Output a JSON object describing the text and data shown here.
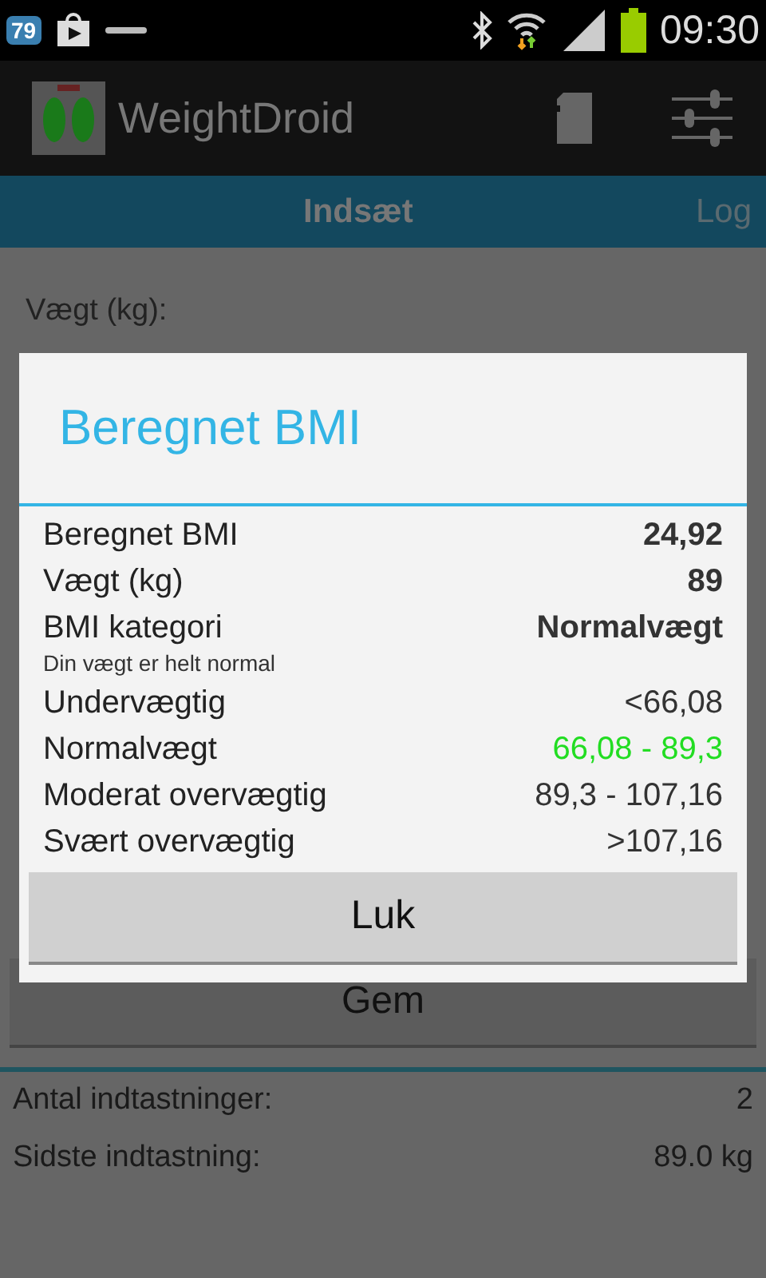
{
  "status_bar": {
    "notification_count": "79",
    "time": "09:30"
  },
  "action_bar": {
    "title": "WeightDroid"
  },
  "tabs": [
    {
      "label": "Indsæt",
      "selected": true
    },
    {
      "label": "Log",
      "selected": false
    }
  ],
  "form": {
    "weight_label": "Vægt (kg):",
    "save_button": "Gem"
  },
  "stats": [
    {
      "label": "Antal indtastninger:",
      "value": "2"
    },
    {
      "label": "Sidste indtastning:",
      "value": "89.0 kg"
    }
  ],
  "dialog": {
    "title": "Beregnet BMI",
    "rows": [
      {
        "label": "Beregnet BMI",
        "value": "24,92",
        "bold": true
      },
      {
        "label": "Vægt (kg)",
        "value": "89",
        "bold": true
      },
      {
        "label": "BMI kategori",
        "value": "Normalvægt",
        "bold": true,
        "note": "Din vægt er helt normal"
      }
    ],
    "ranges": [
      {
        "label": "Undervægtig",
        "value": "<66,08",
        "current": false
      },
      {
        "label": "Normalvægt",
        "value": "66,08 - 89,3",
        "current": true
      },
      {
        "label": "Moderat overvægtig",
        "value": "89,3 - 107,16",
        "current": false
      },
      {
        "label": "Svært overvægtig",
        "value": ">107,16",
        "current": false
      }
    ],
    "close_button": "Luk"
  }
}
